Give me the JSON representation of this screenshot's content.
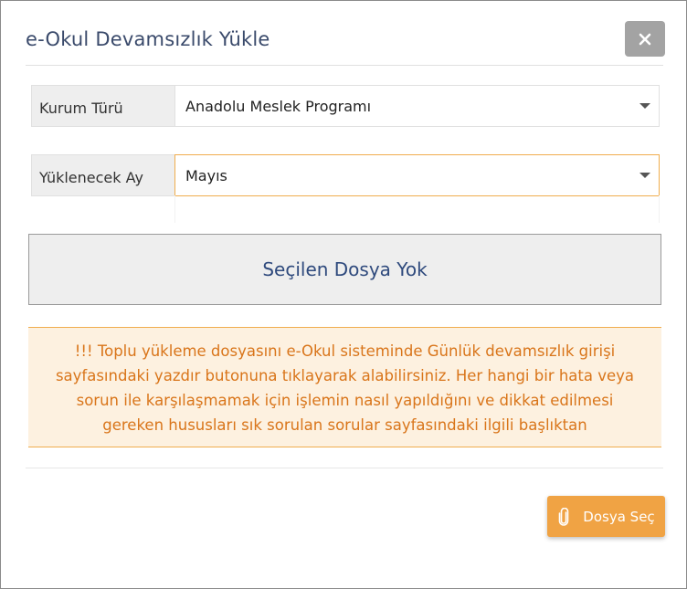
{
  "dialog": {
    "title": "e-Okul Devamsızlık Yükle",
    "close_icon": "close-icon"
  },
  "form": {
    "institution_type": {
      "label": "Kurum Türü",
      "selected": "Anadolu Meslek Programı"
    },
    "upload_month": {
      "label": "Yüklenecek Ay",
      "selected": "Mayıs"
    }
  },
  "file_status": "Seçilen Dosya Yok",
  "warning_text": "!!! Toplu yükleme dosyasını e-Okul sisteminde Günlük devamsızlık girişi sayfasındaki yazdır butonuna tıklayarak alabilirsiniz. Her hangi bir hata veya sorun ile karşılaşmamak için işlemin nasıl yapıldığını ve dikkat edilmesi gereken hususları sık sorulan sorular sayfasındaki ilgili başlıktan",
  "footer": {
    "choose_file_label": "Dosya Seç",
    "choose_file_icon": "paperclip-icon"
  },
  "colors": {
    "accent": "#f0a344",
    "warning_text": "#d9751a",
    "warning_bg": "#fdf1e0",
    "title": "#3a4a6b",
    "file_status_text": "#2f4a7d"
  }
}
